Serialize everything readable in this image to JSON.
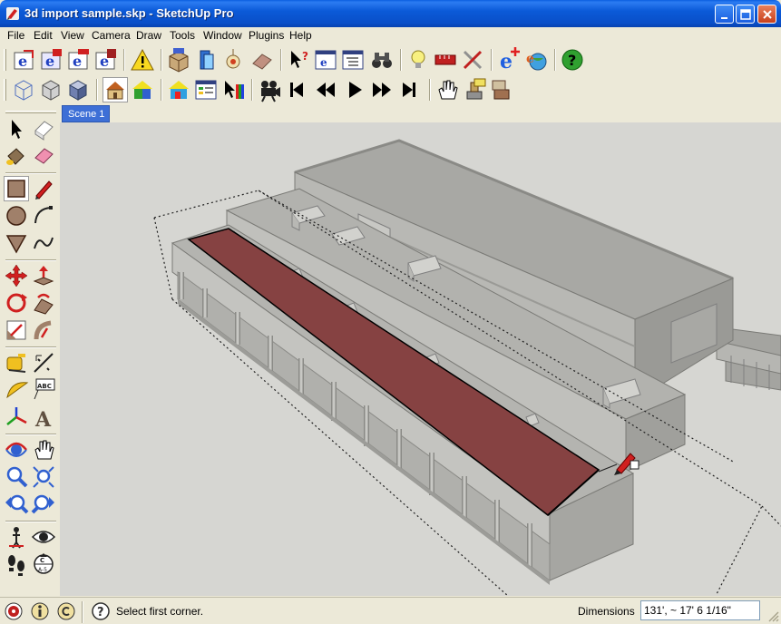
{
  "window": {
    "title": "3d import sample.skp - SketchUp Pro"
  },
  "menu": [
    "File",
    "Edit",
    "View",
    "Camera",
    "Draw",
    "Tools",
    "Window",
    "Plugins",
    "Help"
  ],
  "scene_tab": "Scene 1",
  "status": {
    "hint": "Select first corner.",
    "dimensions_label": "Dimensions",
    "dimensions_value": "131', ~ 17' 6 1/16\""
  },
  "colors": {
    "titlebar": "#0a5ee0",
    "face_selected": "#864242",
    "building": "#9c9c98",
    "viewport_bg": "#d6d6d2"
  },
  "icons": {
    "palette": [
      "select-icon",
      "eraser-icon",
      "paint-bucket-icon",
      "erase-pink-icon",
      "rectangle-icon",
      "pencil-icon",
      "circle-icon",
      "arc-icon",
      "polygon-icon",
      "freehand-icon",
      "move-icon",
      "push-pull-icon",
      "rotate-icon",
      "follow-me-icon",
      "scale-icon",
      "offset-icon",
      "tape-measure-icon",
      "dimension-icon",
      "protractor-icon",
      "text-icon",
      "axes-icon",
      "3d-text-icon",
      "orbit-icon",
      "pan-icon",
      "zoom-icon",
      "zoom-extents-icon",
      "previous-view-icon",
      "next-view-icon",
      "position-camera-icon",
      "look-around-icon",
      "walk-icon",
      "section-plane-icon"
    ]
  }
}
